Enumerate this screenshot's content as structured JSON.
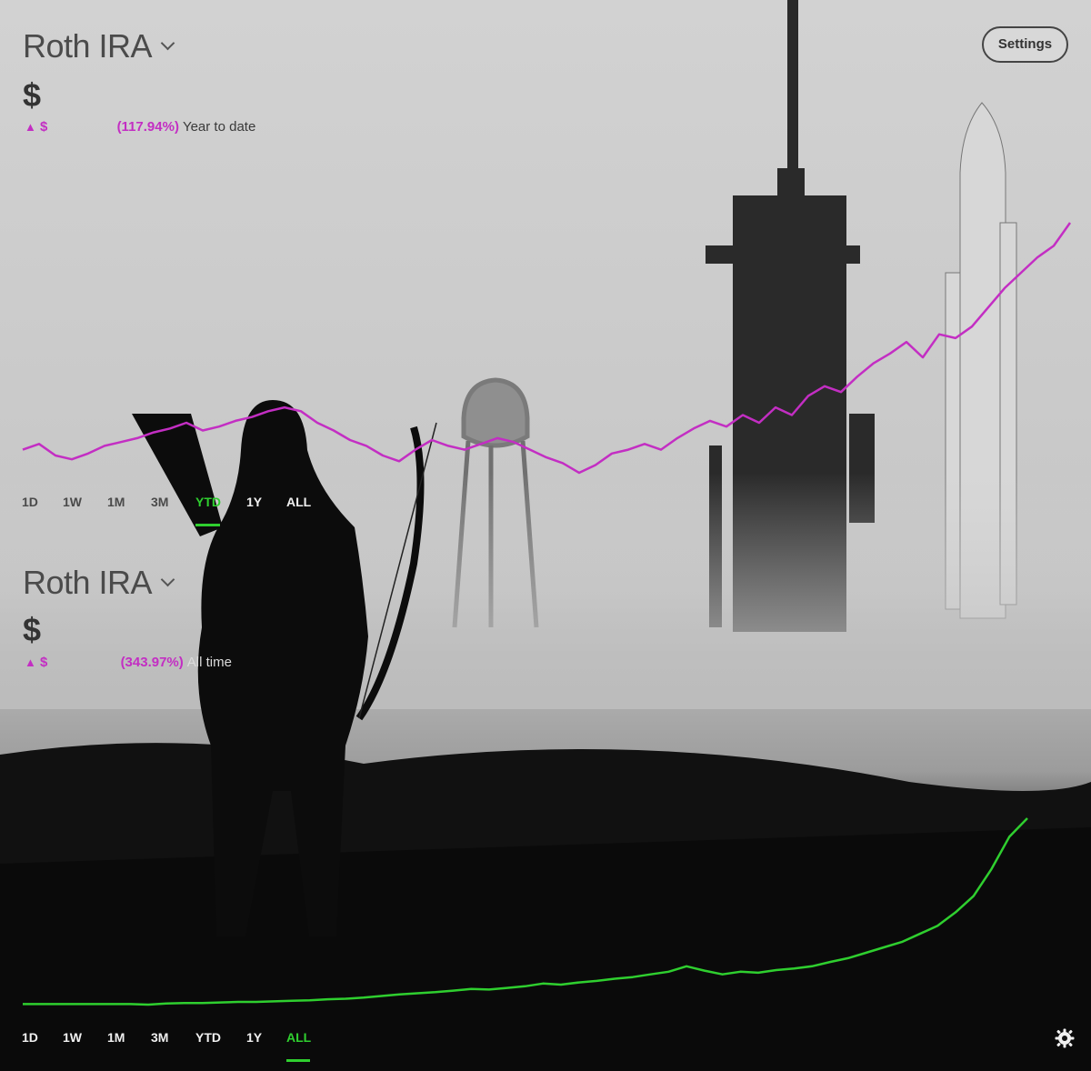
{
  "colors": {
    "accent_up": "#c32ec3",
    "accent_green": "#2fcf2f",
    "text_dark": "#333333",
    "text_light": "#f0f0f0"
  },
  "header": {
    "settings_label": "Settings"
  },
  "top_panel": {
    "account_name": "Roth IRA",
    "balance": "$",
    "change": {
      "arrow": "▲",
      "currency": "$",
      "percent": "(117.94%)",
      "period": "Year to date"
    },
    "ranges": [
      "1D",
      "1W",
      "1M",
      "3M",
      "YTD",
      "1Y",
      "ALL"
    ],
    "selected_range": "YTD"
  },
  "bottom_panel": {
    "account_name": "Roth IRA",
    "balance": "$",
    "change": {
      "arrow": "▲",
      "currency": "$",
      "percent": "(343.97%)",
      "period": "All time"
    },
    "ranges": [
      "1D",
      "1W",
      "1M",
      "3M",
      "YTD",
      "1Y",
      "ALL"
    ],
    "selected_range": "ALL"
  },
  "icons": [
    "chevron-down-icon",
    "gear-icon",
    "triangle-up-icon"
  ],
  "chart_data": [
    {
      "type": "line",
      "title": "",
      "xlabel": "",
      "ylabel": "",
      "series": [
        {
          "color": "#c32ec3",
          "values": [
            0.0,
            0.03,
            -0.03,
            -0.05,
            -0.02,
            0.02,
            0.04,
            0.06,
            0.09,
            0.11,
            0.14,
            0.1,
            0.12,
            0.15,
            0.17,
            0.2,
            0.22,
            0.2,
            0.14,
            0.1,
            0.05,
            0.02,
            -0.03,
            -0.06,
            0.0,
            0.05,
            0.02,
            0.0,
            0.03,
            0.06,
            0.04,
            0.0,
            -0.04,
            -0.07,
            -0.12,
            -0.08,
            -0.02,
            0.0,
            0.03,
            0.0,
            0.06,
            0.11,
            0.15,
            0.12,
            0.18,
            0.14,
            0.22,
            0.18,
            0.28,
            0.33,
            0.3,
            0.38,
            0.45,
            0.5,
            0.56,
            0.48,
            0.6,
            0.58,
            0.64,
            0.74,
            0.84,
            0.92,
            1.0,
            1.06,
            1.18
          ]
        },
        {
          "color": "#2fcf2f",
          "values": [
            0.0,
            0.0,
            0.0,
            0.0,
            0.0,
            0.0,
            0.0,
            -0.01,
            0.01,
            0.02,
            0.02,
            0.03,
            0.04,
            0.04,
            0.05,
            0.06,
            0.07,
            0.09,
            0.1,
            0.12,
            0.15,
            0.18,
            0.2,
            0.22,
            0.25,
            0.28,
            0.27,
            0.3,
            0.33,
            0.38,
            0.36,
            0.4,
            0.43,
            0.47,
            0.5,
            0.55,
            0.6,
            0.7,
            0.62,
            0.55,
            0.6,
            0.58,
            0.63,
            0.66,
            0.7,
            0.78,
            0.85,
            0.95,
            1.05,
            1.15,
            1.3,
            1.45,
            1.7,
            2.0,
            2.5,
            3.1,
            3.44
          ]
        }
      ]
    }
  ]
}
